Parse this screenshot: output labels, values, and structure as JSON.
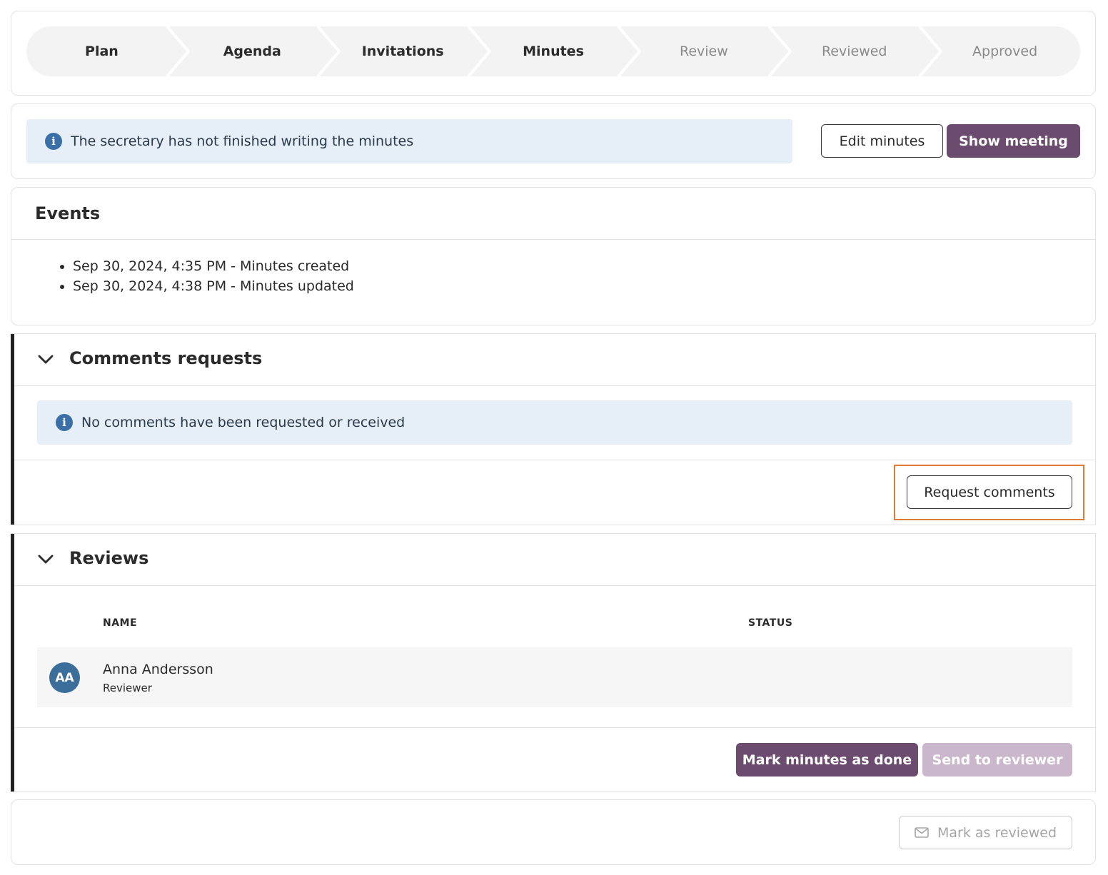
{
  "stepper": {
    "steps": [
      {
        "label": "Plan",
        "state": "done"
      },
      {
        "label": "Agenda",
        "state": "done"
      },
      {
        "label": "Invitations",
        "state": "done"
      },
      {
        "label": "Minutes",
        "state": "current"
      },
      {
        "label": "Review",
        "state": "pending"
      },
      {
        "label": "Reviewed",
        "state": "pending"
      },
      {
        "label": "Approved",
        "state": "pending"
      }
    ]
  },
  "status": {
    "message": "The secretary has not finished writing the minutes",
    "edit_label": "Edit minutes",
    "show_label": "Show meeting"
  },
  "events": {
    "title": "Events",
    "items": [
      "Sep 30, 2024, 4:35 PM - Minutes created",
      "Sep 30, 2024, 4:38 PM - Minutes updated"
    ]
  },
  "comments": {
    "title": "Comments requests",
    "empty_message": "No comments have been requested or received",
    "request_label": "Request comments"
  },
  "reviews": {
    "title": "Reviews",
    "col_name": "NAME",
    "col_status": "STATUS",
    "rows": [
      {
        "initials": "AA",
        "name": "Anna Andersson",
        "role": "Reviewer",
        "status": ""
      }
    ],
    "mark_done_label": "Mark minutes as done",
    "send_label": "Send to reviewer"
  },
  "footer": {
    "mark_reviewed_label": "Mark as reviewed"
  },
  "colors": {
    "primary": "#6c4c6e",
    "primary_disabled": "#cbb7cb",
    "info_bg": "#e6eef7",
    "info_icon": "#3a6fa8",
    "avatar": "#3c6e9c",
    "highlight": "#e07a36"
  },
  "icons": {
    "info": "info-icon",
    "chevron": "chevron-down-icon",
    "mail": "mail-icon"
  }
}
